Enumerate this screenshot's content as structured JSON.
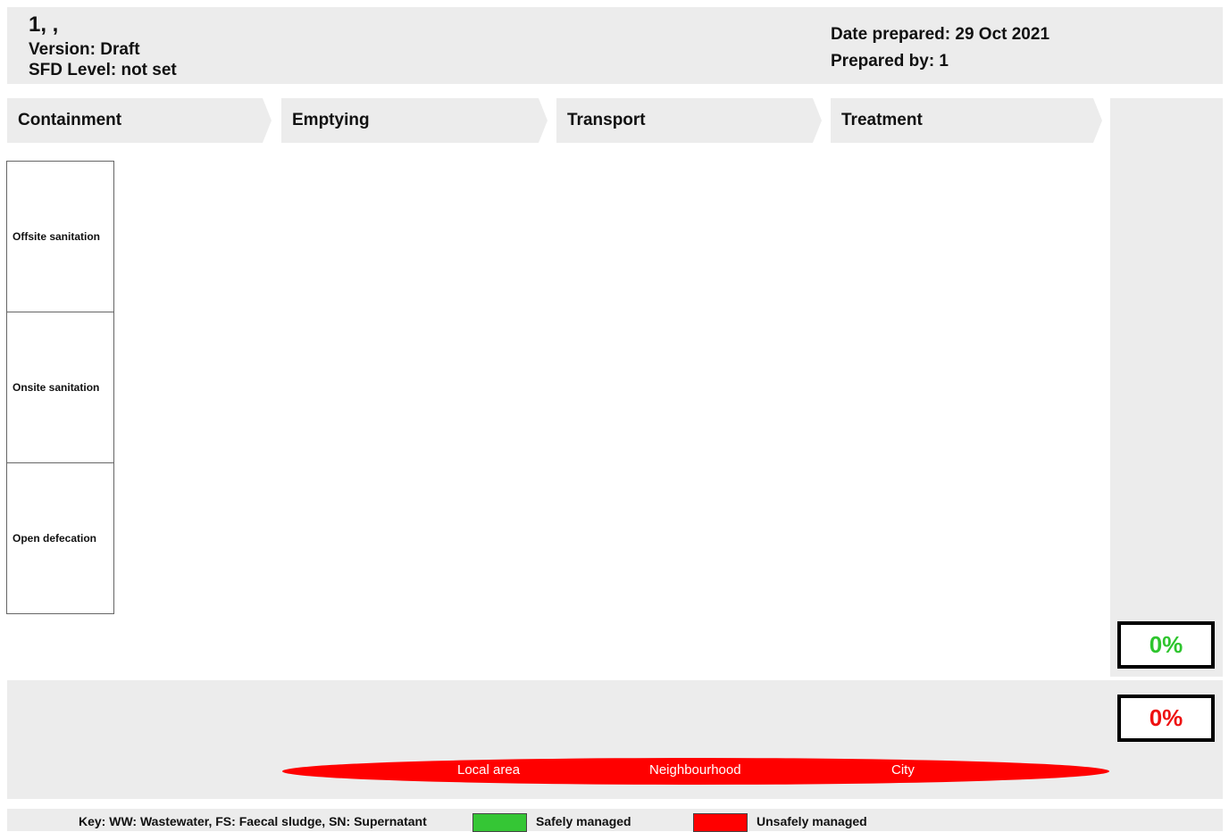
{
  "header": {
    "id": "1, ,",
    "version": "Version: Draft",
    "sfd_level": "SFD Level: not set",
    "date_prepared": "Date prepared: 29 Oct 2021",
    "prepared_by": "Prepared by: 1"
  },
  "stages": [
    "Containment",
    "Emptying",
    "Transport",
    "Treatment"
  ],
  "categories": [
    "Offsite sanitation",
    "Onsite sanitation",
    "Open defecation"
  ],
  "percent": {
    "safe": "0%",
    "unsafe": "0%"
  },
  "scale": {
    "local": "Local area",
    "neighbourhood": "Neighbourhood",
    "city": "City"
  },
  "key": {
    "text": "Key: WW: Wastewater, FS: Faecal sludge, SN: Supernatant",
    "safe_label": "Safely managed",
    "unsafe_label": "Unsafely managed"
  },
  "colors": {
    "safe": "#35c635",
    "unsafe": "#ff0000",
    "panel": "#ececec"
  }
}
